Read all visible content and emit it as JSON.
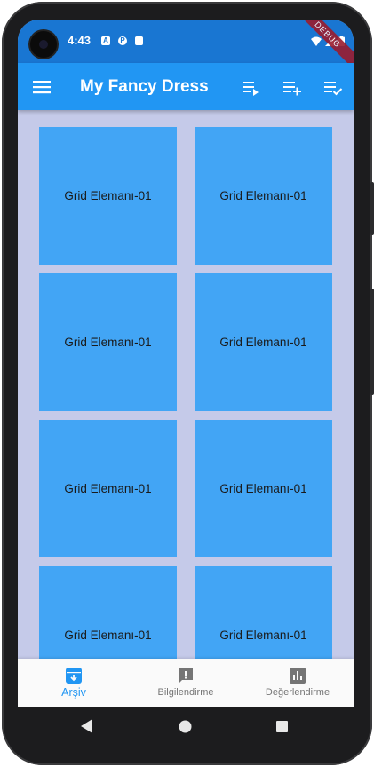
{
  "status_bar": {
    "time": "4:43",
    "debug_label": "DEBUG",
    "icons": [
      "a-notification-icon",
      "p-notification-icon",
      "sd-card-icon",
      "wifi-icon",
      "signal-icon",
      "battery-icon"
    ]
  },
  "app_bar": {
    "title": "My Fancy Dress",
    "actions": [
      "playlist-play-icon",
      "playlist-add-icon",
      "playlist-add-check-icon"
    ]
  },
  "grid": {
    "items": [
      "Grid Elemanı-01",
      "Grid Elemanı-01",
      "Grid Elemanı-01",
      "Grid Elemanı-01",
      "Grid Elemanı-01",
      "Grid Elemanı-01",
      "Grid Elemanı-01",
      "Grid Elemanı-01"
    ]
  },
  "bottom_nav": {
    "items": [
      {
        "label": "Arşiv",
        "icon": "archive-icon",
        "active": true
      },
      {
        "label": "Bilgilendirme",
        "icon": "announcement-icon",
        "active": false
      },
      {
        "label": "Değerlendirme",
        "icon": "assessment-icon",
        "active": false
      }
    ]
  },
  "system_nav": [
    "back-icon",
    "home-icon",
    "recents-icon"
  ],
  "colors": {
    "status_bar": "#1976d2",
    "app_bar": "#2196f3",
    "background": "#c5cae9",
    "grid_item": "#42a5f5",
    "nav_active": "#2196f3",
    "nav_inactive": "#757575"
  }
}
